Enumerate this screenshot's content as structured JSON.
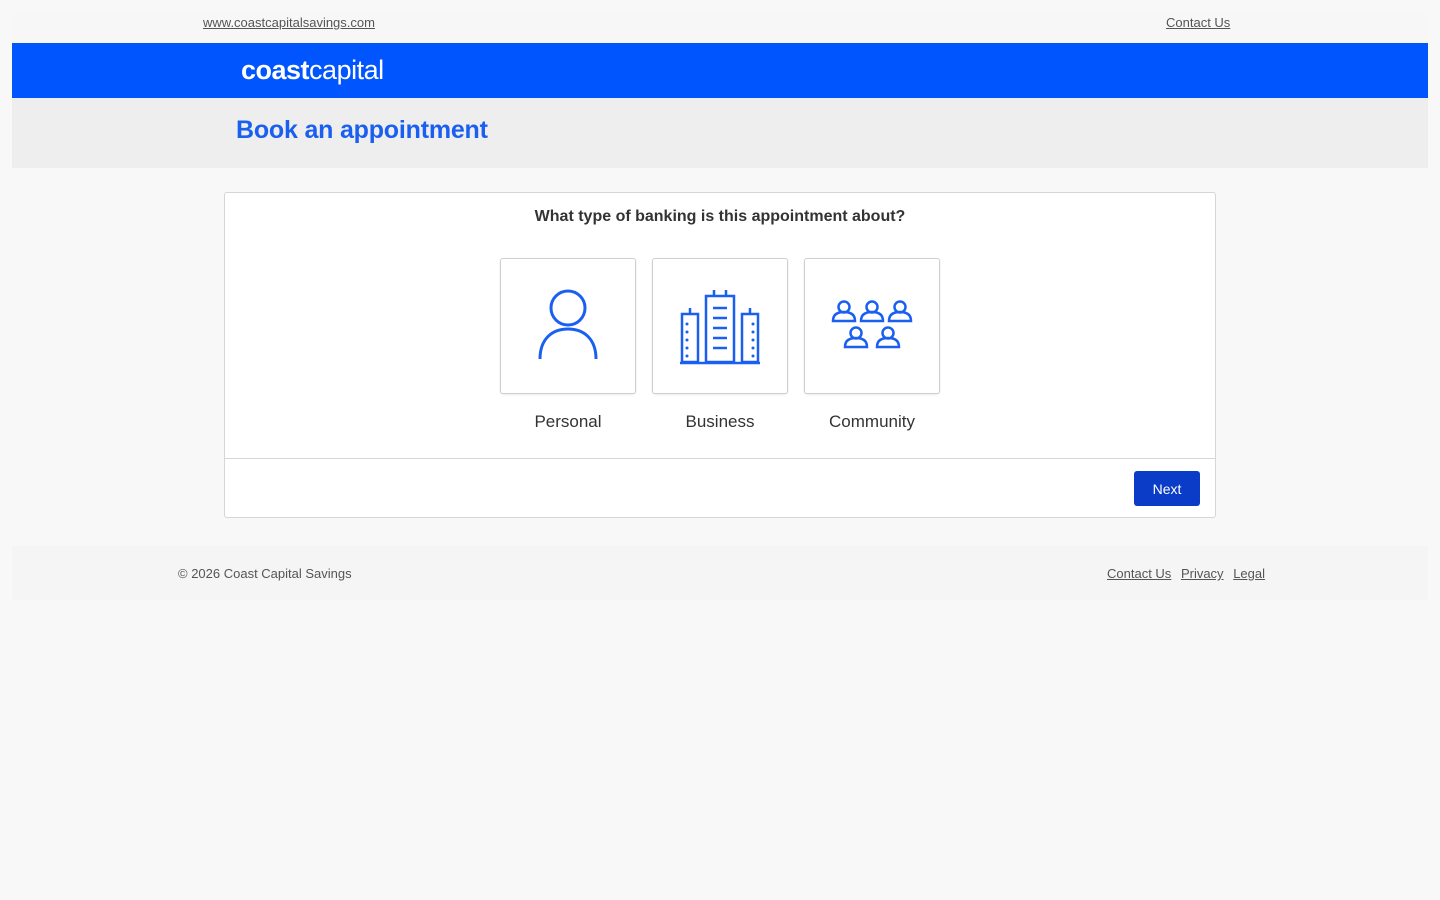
{
  "topbar": {
    "site_link": "www.coastcapitalsavings.com",
    "contact_link": "Contact Us"
  },
  "brand": {
    "logo_bold": "coast",
    "logo_light": "capital",
    "color": "#0055ff"
  },
  "header": {
    "title": "Book an appointment"
  },
  "form": {
    "question": "What type of banking is this appointment about?",
    "options": [
      {
        "label": "Personal",
        "icon": "person-icon"
      },
      {
        "label": "Business",
        "icon": "buildings-icon"
      },
      {
        "label": "Community",
        "icon": "group-icon"
      }
    ],
    "next_label": "Next",
    "accent_color": "#1a5ff0",
    "button_color": "#0a3cc7"
  },
  "footer": {
    "copyright": "© 2026 Coast Capital Savings",
    "links": [
      "Contact Us",
      "Privacy",
      "Legal"
    ]
  }
}
